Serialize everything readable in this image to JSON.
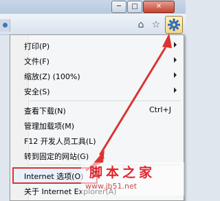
{
  "window": {
    "minimize_glyph": "─",
    "maximize_glyph": "□",
    "close_glyph": "✕"
  },
  "toolbar": {
    "home_icon": "home-icon",
    "favorites_icon": "star-icon",
    "tools_icon": "gear-icon"
  },
  "menu": {
    "items": [
      {
        "label": "打印(P)",
        "submenu": true
      },
      {
        "label": "文件(F)",
        "submenu": true
      },
      {
        "label": "缩放(Z) (100%)",
        "submenu": true
      },
      {
        "label": "安全(S)",
        "submenu": true
      },
      {
        "label": "查看下载(N)",
        "shortcut": "Ctrl+J"
      },
      {
        "label": "管理加载项(M)"
      },
      {
        "label": "F12 开发人员工具(L)"
      },
      {
        "label": "转到固定的网站(G)"
      },
      {
        "label": "Internet 选项(O)",
        "highlighted": true
      },
      {
        "label": "关于 Internet Explorer(A)"
      }
    ]
  },
  "annotation": {
    "color": "#d93432"
  },
  "watermark": {
    "title": "脚本之家",
    "url": "www.jb51.net"
  }
}
